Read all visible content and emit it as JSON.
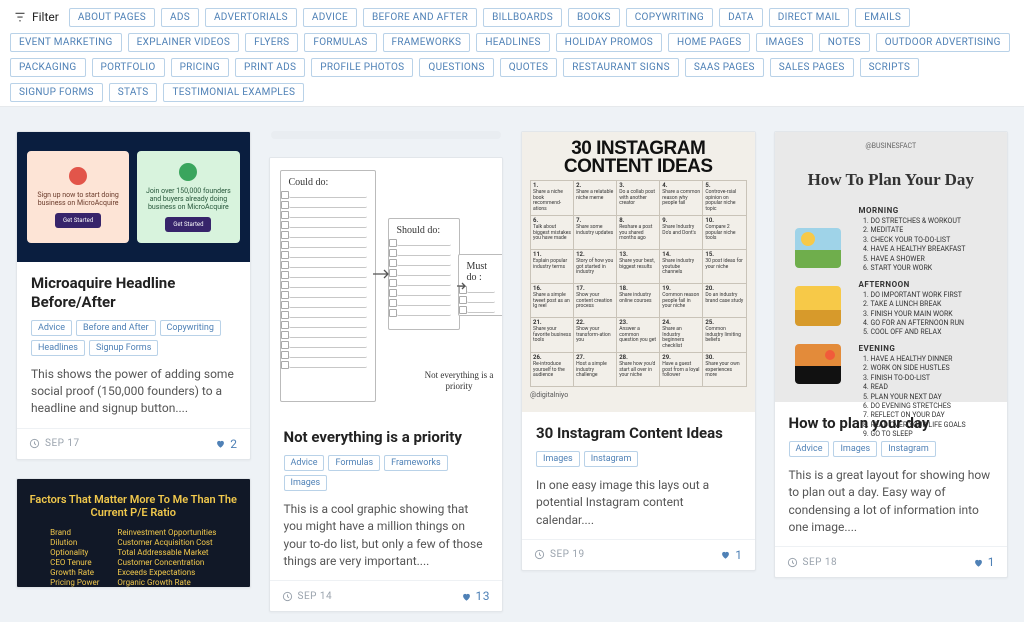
{
  "filter_label": "Filter",
  "filter_tags": [
    "ABOUT PAGES",
    "ADS",
    "ADVERTORIALS",
    "ADVICE",
    "BEFORE AND AFTER",
    "BILLBOARDS",
    "BOOKS",
    "COPYWRITING",
    "DATA",
    "DIRECT MAIL",
    "EMAILS",
    "EVENT MARKETING",
    "EXPLAINER VIDEOS",
    "FLYERS",
    "FORMULAS",
    "FRAMEWORKS",
    "HEADLINES",
    "HOLIDAY PROMOS",
    "HOME PAGES",
    "IMAGES",
    "NOTES",
    "OUTDOOR ADVERTISING",
    "PACKAGING",
    "PORTFOLIO",
    "PRICING",
    "PRINT ADS",
    "PROFILE PHOTOS",
    "QUESTIONS",
    "QUOTES",
    "RESTAURANT SIGNS",
    "SAAS PAGES",
    "SALES PAGES",
    "SCRIPTS",
    "SIGNUP FORMS",
    "STATS",
    "TESTIMONIAL EXAMPLES"
  ],
  "cards": {
    "c1": {
      "thumb": {
        "left_text": "Sign up now to start doing business on MicroAcquire",
        "right_text": "Join over 150,000 founders and buyers already doing business on MicroAcquire",
        "btn": "Get Started"
      },
      "title": "Microaquire Headline Before/After",
      "chips": [
        "Advice",
        "Before and After",
        "Copywriting",
        "Headlines",
        "Signup Forms"
      ],
      "excerpt": "This shows the power of adding some social proof (150,000 founders) to a headline and signup button....",
      "date": "SEP 17",
      "likes": "2"
    },
    "c2": {
      "thumb": {
        "l1": "Could do:",
        "l2": "Should do:",
        "l3": "Must do :",
        "note": "Not everything is a priority"
      },
      "title": "Not everything is a priority",
      "chips": [
        "Advice",
        "Formulas",
        "Frameworks",
        "Images"
      ],
      "excerpt": "This is a cool graphic showing that you might have a million things on your to-do list, but only a few of those things are very important....",
      "date": "SEP 14",
      "likes": "13"
    },
    "c3": {
      "thumb": {
        "heading": "30 INSTAGRAM CONTENT IDEAS",
        "handle": "@digitalniyo",
        "cells": [
          [
            "1.",
            "Share a niche book recommend-ations"
          ],
          [
            "2.",
            "Share a relatable niche meme"
          ],
          [
            "3.",
            "Do a collab post with another creator"
          ],
          [
            "4.",
            "Share a common reason why people fail"
          ],
          [
            "5.",
            "Controve-rsial opinion on popular niche topic"
          ],
          [
            "6.",
            "Talk about biggest mistakes you have made"
          ],
          [
            "7.",
            "Share some industry updates"
          ],
          [
            "8.",
            "Reshare a post you shared months ago"
          ],
          [
            "9.",
            "Share Industry Do's and Dont's"
          ],
          [
            "10.",
            "Compare 2 popular niche tools"
          ],
          [
            "11.",
            "Explain popular industry terms"
          ],
          [
            "12.",
            "Story of how you got started in industry"
          ],
          [
            "13.",
            "Share your best, biggest results"
          ],
          [
            "14.",
            "Share industry youtube channels"
          ],
          [
            "15.",
            "30 post ideas for your niche"
          ],
          [
            "16.",
            "Share a simple tweet post as an Ig reel"
          ],
          [
            "17.",
            "Show your content creation process"
          ],
          [
            "18.",
            "Share industry online courses"
          ],
          [
            "19.",
            "Common reason people fail in your niche"
          ],
          [
            "20.",
            "Do an industry brand case study"
          ],
          [
            "21.",
            "Share your favorite business tools"
          ],
          [
            "22.",
            "Show your transform-ation you"
          ],
          [
            "23.",
            "Answer a common question you get"
          ],
          [
            "24.",
            "Share an Industry beginners checklist"
          ],
          [
            "25.",
            "Common industry limiting beliefs"
          ],
          [
            "26.",
            "Re-introduce yourself to the audience"
          ],
          [
            "27.",
            "Host a simple industry challenge"
          ],
          [
            "28.",
            "Share how you'd start all over in your niche"
          ],
          [
            "29.",
            "Have a guest post from a loyal follower"
          ],
          [
            "30.",
            "Share your own experiences more"
          ]
        ]
      },
      "title": "30 Instagram Content Ideas",
      "chips": [
        "Images",
        "Instagram"
      ],
      "excerpt": "In one easy image this lays out a potential Instagram content calendar....",
      "date": "SEP 19",
      "likes": "1"
    },
    "c4": {
      "thumb": {
        "handle": "@BUSINESFACT",
        "heading": "How To Plan Your Day",
        "sections": [
          {
            "label": "MORNING",
            "items": [
              "DO STRETCHES & WORKOUT",
              "MEDITATE",
              "CHECK YOUR TO-DO-LIST",
              "HAVE A HEALTHY BREAKFAST",
              "HAVE A SHOWER",
              "START YOUR WORK"
            ]
          },
          {
            "label": "AFTERNOON",
            "items": [
              "DO IMPORTANT WORK FIRST",
              "TAKE A LUNCH BREAK",
              "FINISH YOUR MAIN WORK",
              "GO FOR AN AFTERNOON RUN",
              "COOL OFF AND RELAX"
            ]
          },
          {
            "label": "EVENING",
            "items": [
              "HAVE A HEALTHY DINNER",
              "WORK ON SIDE HUSTLES",
              "FINISH TO-DO-LIST",
              "READ",
              "PLAN YOUR NEXT DAY",
              "DO EVENING STRETCHES",
              "REFLECT ON YOUR DAY",
              "READ OVER YOUR LIFE GOALS",
              "GO TO SLEEP"
            ]
          }
        ]
      },
      "title": "How to plan your day",
      "chips": [
        "Advice",
        "Images",
        "Instagram"
      ],
      "excerpt": "This is a great layout for showing how to plan out a day. Easy way of condensing a lot of information into one image....",
      "date": "SEP 18",
      "likes": "1"
    },
    "c5": {
      "heading": "Factors That Matter More To Me Than The Current P/E Ratio",
      "left": [
        "Brand",
        "Dilution",
        "Optionality",
        "CEO Tenure",
        "Growth Rate",
        "Pricing Power"
      ],
      "right": [
        "Reinvestment Opportunities",
        "Customer Acquisition Cost",
        "Total Addressable Market",
        "Customer Concentration",
        "Exceeds Expectations",
        "Organic Growth Rate"
      ]
    }
  }
}
